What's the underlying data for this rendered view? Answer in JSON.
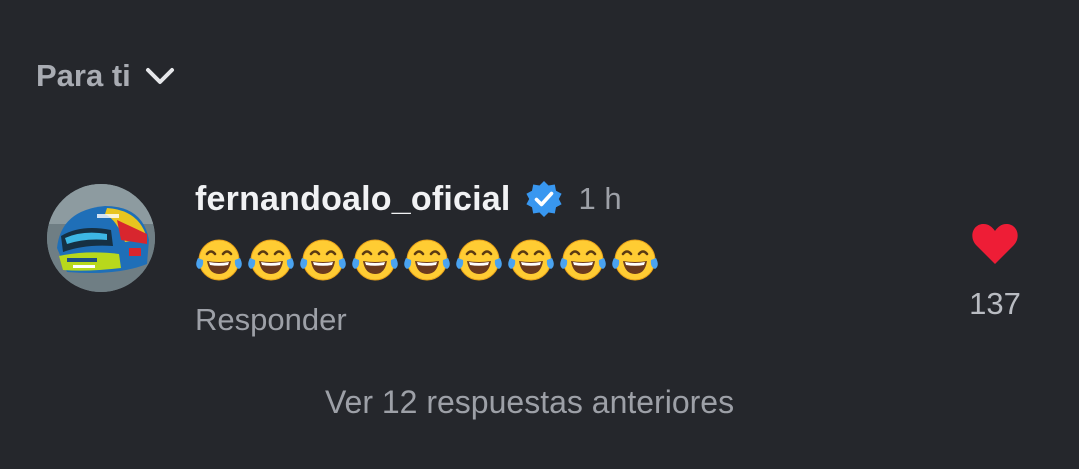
{
  "filter": {
    "label": "Para ti",
    "icon": "chevron-down-icon"
  },
  "comment": {
    "avatar_icon": "helmet-avatar",
    "username": "fernandoalo_oficial",
    "verified_icon": "verified-badge-icon",
    "verified_color": "#3897f0",
    "time": "1 h",
    "text": "😂😂😂😂😂😂😂😂😂",
    "emoji_icon": "face-with-tears-of-joy",
    "reply_label": "Responder",
    "like_icon": "heart-icon",
    "like_color": "#ee1d36",
    "like_count": "137"
  },
  "view_replies": "Ver 12 respuestas anteriores",
  "colors": {
    "background": "#25272c",
    "text_primary": "#f1f2f4",
    "text_secondary": "#9da0a7"
  }
}
